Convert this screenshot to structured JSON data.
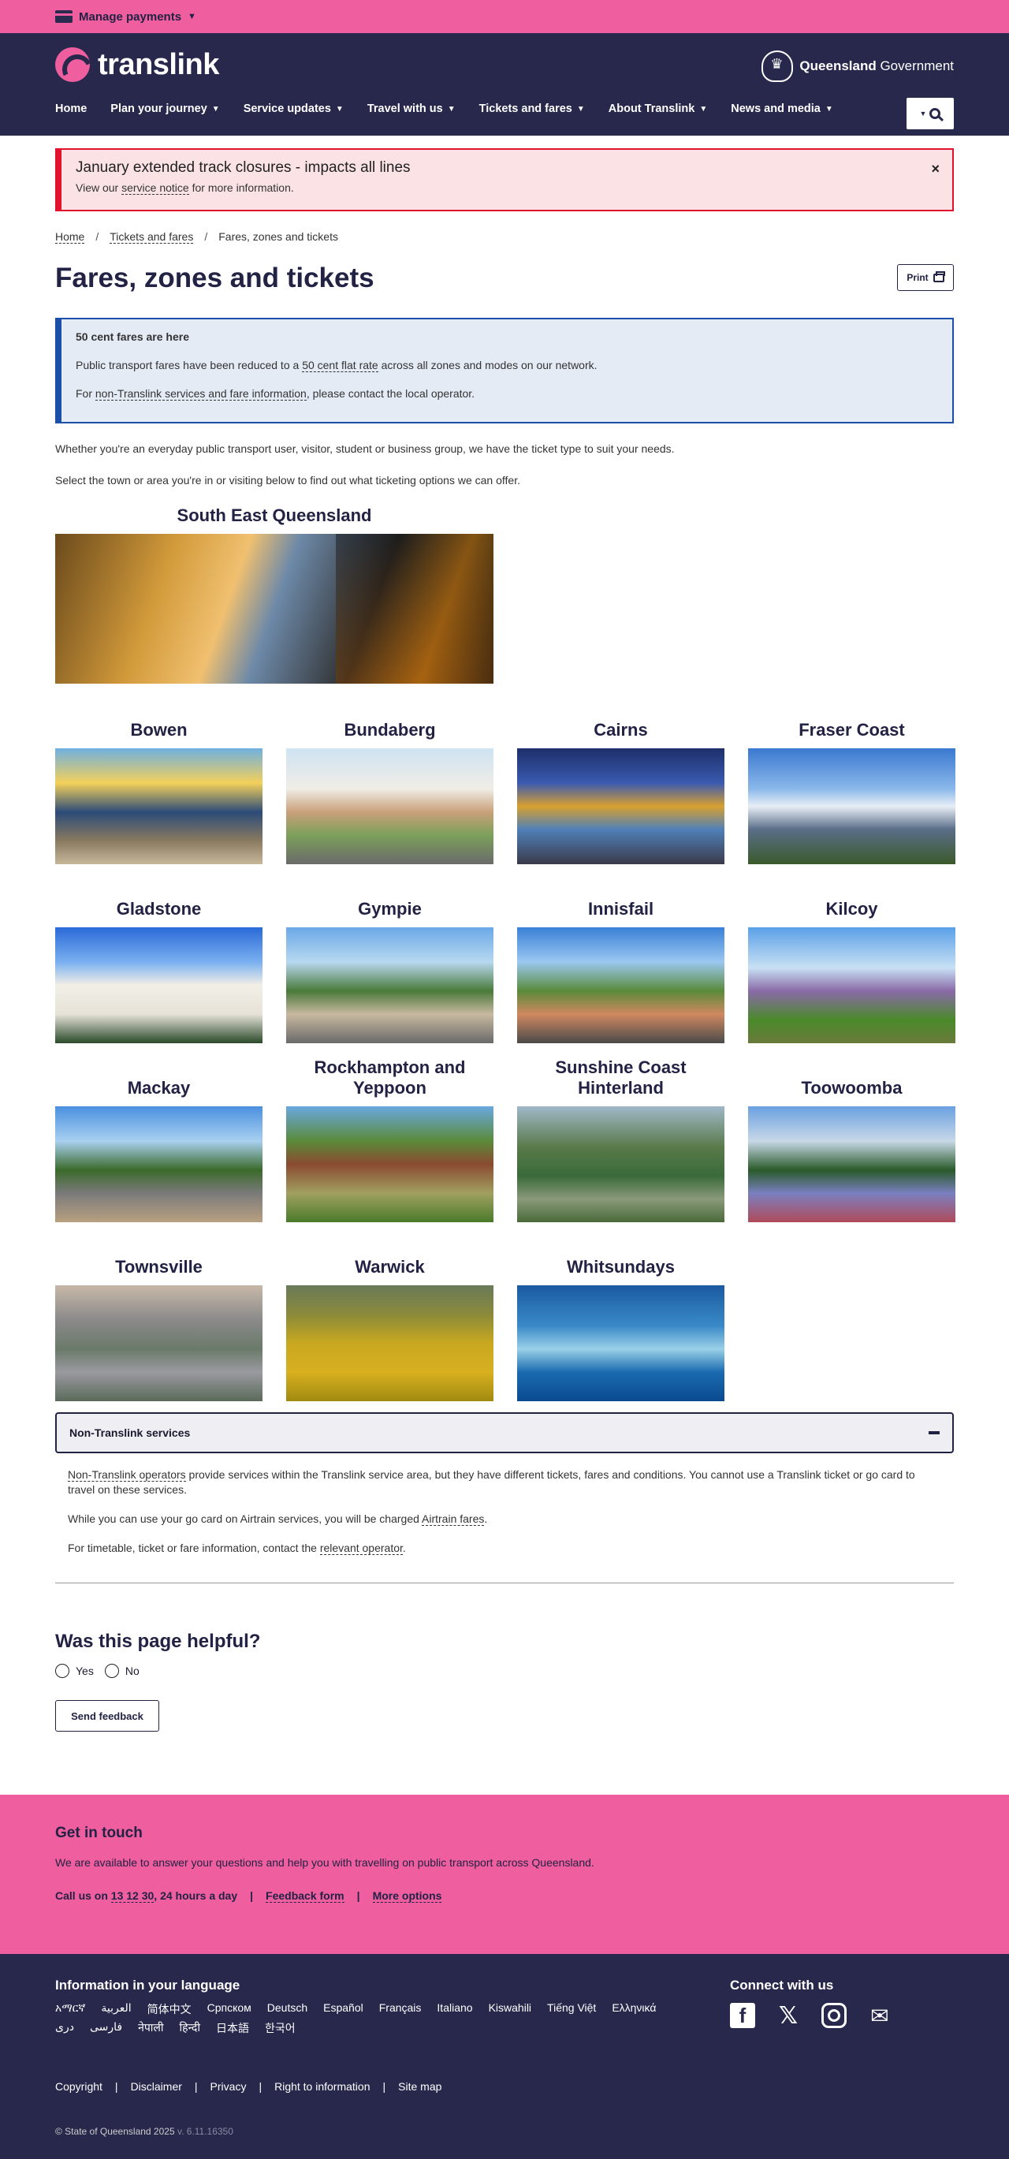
{
  "topbar": {
    "manage_payments": "Manage payments"
  },
  "header": {
    "brand": "translink",
    "gov_bold": "Queensland",
    "gov_rest": " Government",
    "nav": [
      "Home",
      "Plan your journey",
      "Service updates",
      "Travel with us",
      "Tickets and fares",
      "About Translink",
      "News and media"
    ]
  },
  "alert": {
    "title": "January extended track closures - impacts all lines",
    "text_before": "View our ",
    "link": "service notice",
    "text_after": " for more information.",
    "close": "×"
  },
  "breadcrumb": {
    "items": [
      "Home",
      "Tickets and fares",
      "Fares, zones and tickets"
    ],
    "sep": "/"
  },
  "page": {
    "title": "Fares, zones and tickets",
    "print": "Print"
  },
  "infobox": {
    "title": "50 cent fares are here",
    "p1_before": "Public transport fares have been reduced to a ",
    "p1_link": "50 cent flat rate",
    "p1_after": " across all zones and modes on our network.",
    "p2_before": "For ",
    "p2_link": "non-Translink services and fare information",
    "p2_after": ", please contact the local operator."
  },
  "intro": [
    "Whether you're an everyday public transport user, visitor, student or business group, we have the ticket type to suit your needs.",
    "Select the town or area you're in or visiting below to find out what ticketing options we can offer."
  ],
  "regions": {
    "featured": "South East Queensland",
    "tiles": [
      {
        "name": "Bowen",
        "g": "linear-gradient(180deg,#6fb0e0 0%,#f4d05a 30%,#2b4b78 55%,#8a7a60 80%,#c7b79a 100%)"
      },
      {
        "name": "Bundaberg",
        "g": "linear-gradient(180deg,#cfe3f2 0%,#f0ede6 35%,#c9a07a 55%,#7ca05a 75%,#6a6a6a 100%)"
      },
      {
        "name": "Cairns",
        "g": "linear-gradient(180deg,#1d2f6a 0%,#3a5ab0 30%,#d8a030 50%,#5080b8 70%,#3a3a4a 100%)"
      },
      {
        "name": "Fraser Coast",
        "g": "linear-gradient(180deg,#3a78d0 0%,#8ab8ea 35%,#e8eef6 50%,#5a6e88 70%,#3a5a2a 100%)"
      },
      {
        "name": "Gladstone",
        "g": "linear-gradient(180deg,#2a6ad8 0%,#7ab0f0 30%,#f2efe6 50%,#e6e2d8 75%,#2a4a2a 100%)"
      },
      {
        "name": "Gympie",
        "g": "linear-gradient(180deg,#6aa8e8 0%,#b8d8f0 30%,#4a7a3a 55%,#c8b8a0 75%,#6a6a6a 100%)"
      },
      {
        "name": "Innisfail",
        "g": "linear-gradient(180deg,#3a80d8 0%,#9ac8f0 30%,#5a8a3a 55%,#d08860 75%,#4a4a4a 100%)"
      },
      {
        "name": "Kilcoy",
        "g": "linear-gradient(180deg,#5aa0e8 0%,#c8e0f4 35%,#8a6aa8 55%,#4a8a2a 80%,#6a7a3a 100%)"
      },
      {
        "name": "Mackay",
        "g": "linear-gradient(180deg,#4a90e0 0%,#a8d0f0 30%,#3a6a2a 55%,#7a7a7a 75%,#b8a080 100%)"
      },
      {
        "name": "Rockhampton and Yeppoon",
        "g": "linear-gradient(180deg,#6aa8e0 0%,#5a8a3a 30%,#8a4a30 50%,#a0a060 75%,#4a7a2a 100%)"
      },
      {
        "name": "Sunshine Coast Hinterland",
        "g": "linear-gradient(180deg,#a0b8c8 0%,#5a7a4a 35%,#3a6a3a 60%,#8a9a7a 80%,#4a6a3a 100%)"
      },
      {
        "name": "Toowoomba",
        "g": "linear-gradient(180deg,#6aa0e0 0%,#c8d8e8 30%,#2a5a2a 55%,#7a80c0 75%,#b04a5a 100%)"
      },
      {
        "name": "Townsville",
        "g": "linear-gradient(180deg,#c8b8a8 0%,#8a8a8a 30%,#6a7a6a 55%,#9a9aa0 75%,#5a6a5a 100%)"
      },
      {
        "name": "Warwick",
        "g": "linear-gradient(180deg,#6a7a5a 0%,#8a8a3a 25%,#c8a820 50%,#d8b020 75%,#a08a10 100%)"
      },
      {
        "name": "Whitsundays",
        "g": "linear-gradient(180deg,#1a5aa0 0%,#3a8ac8 35%,#9ad0e8 55%,#1a6ab0 75%,#0a4a90 100%)"
      }
    ]
  },
  "accordion": {
    "label": "Non-Translink services",
    "p1_link": "Non-Translink operators",
    "p1_text": " provide services within the Translink service area, but they have different tickets, fares and conditions. You cannot use a Translink ticket or go card to travel on these services.",
    "p2_text": "While you can use your go card on Airtrain services, you will be charged ",
    "p2_link": "Airtrain fares",
    "p3_text": "For timetable, ticket or fare information, contact the ",
    "p3_link": "relevant operator"
  },
  "feedback": {
    "title": "Was this page helpful?",
    "yes": "Yes",
    "no": "No",
    "send": "Send feedback"
  },
  "touch": {
    "title": "Get in touch",
    "text": "We are available to answer your questions and help you with travelling on public transport across Queensland.",
    "call_prefix": "Call us on ",
    "phone": "13 12 30",
    "call_suffix": ", 24 hours a day",
    "feedback_form": "Feedback form",
    "more_options": "More options",
    "sep": "|"
  },
  "footer": {
    "lang_title": "Information in your language",
    "languages": [
      "አማርኛ",
      "العربية",
      "简体中文",
      "Српском",
      "Deutsch",
      "Español",
      "Français",
      "Italiano",
      "Kiswahili",
      "Tiếng Việt",
      "Ελληνικά",
      "دری",
      "فارسی",
      "नेपाली",
      "हिन्दी",
      "日本語",
      "한국어"
    ],
    "social_title": "Connect with us",
    "links": [
      "Copyright",
      "Disclaimer",
      "Privacy",
      "Right to information",
      "Site map"
    ],
    "sep": "|",
    "copyright": "© State of Queensland 2025",
    "version": " v. 6.11.16350"
  }
}
